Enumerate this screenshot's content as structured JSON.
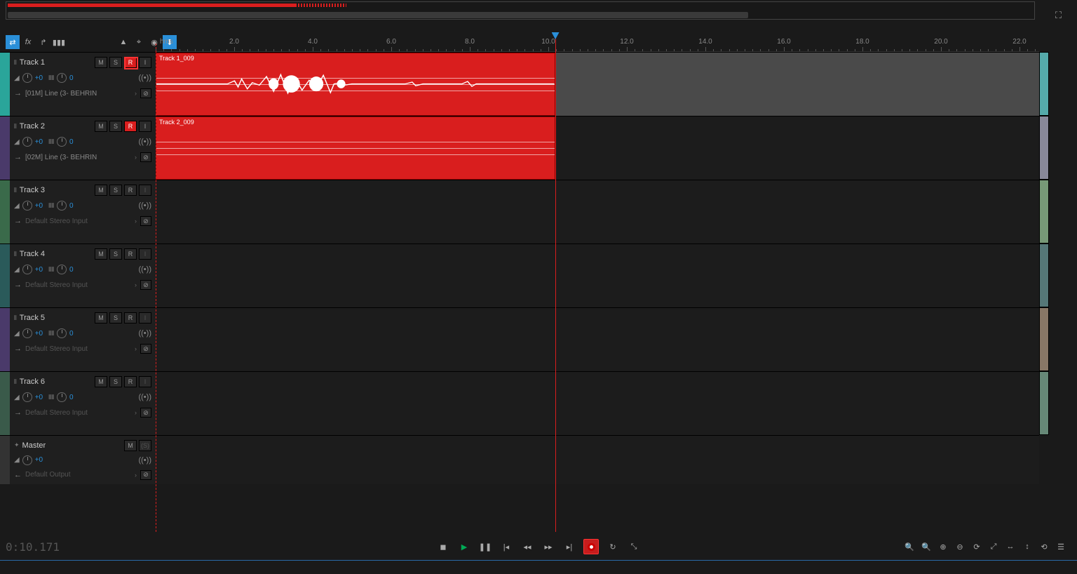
{
  "ruler": {
    "label": "hms",
    "marks": [
      "2.0",
      "4.0",
      "6.0",
      "8.0",
      "10.0",
      "12.0",
      "14.0",
      "16.0",
      "18.0",
      "20.0",
      "22.0"
    ]
  },
  "playhead_seconds": 10.171,
  "timecode": "0:10.171",
  "overview": {
    "red_width_pct": 28,
    "dash_start_pct": 28,
    "dash_width_pct": 5,
    "scroll_width_pct": 72
  },
  "tracks": [
    {
      "name": "Track 1",
      "color": "#2aa59a",
      "m": false,
      "s": false,
      "r": true,
      "i": true,
      "i_active": true,
      "vol": "+0",
      "pan": "0",
      "input": "[01M] Line (3- BEHRIN",
      "input_active": true,
      "clip": {
        "label": "Track 1_009",
        "has_wave": true
      },
      "show_peak_green": true,
      "highlight_r": true
    },
    {
      "name": "Track 2",
      "color": "#4a3a6a",
      "m": false,
      "s": false,
      "r": true,
      "i": true,
      "i_active": true,
      "vol": "+0",
      "pan": "0",
      "input": "[02M] Line (3- BEHRIN",
      "input_active": true,
      "clip": {
        "label": "Track 2_009",
        "has_wave": false
      }
    },
    {
      "name": "Track 3",
      "color": "#3a6a4a",
      "m": false,
      "s": false,
      "r": false,
      "i": false,
      "i_active": false,
      "vol": "+0",
      "pan": "0",
      "input": "Default Stereo Input",
      "input_active": false
    },
    {
      "name": "Track 4",
      "color": "#2a5a5a",
      "m": false,
      "s": false,
      "r": false,
      "i": false,
      "i_active": false,
      "vol": "+0",
      "pan": "0",
      "input": "Default Stereo Input",
      "input_active": false
    },
    {
      "name": "Track 5",
      "color": "#4a3a6a",
      "m": false,
      "s": false,
      "r": false,
      "i": false,
      "i_active": false,
      "vol": "+0",
      "pan": "0",
      "input": "Default Stereo Input",
      "input_active": false
    },
    {
      "name": "Track 6",
      "color": "#3a5a4a",
      "m": false,
      "s": false,
      "r": false,
      "i": false,
      "i_active": false,
      "vol": "+0",
      "pan": "0",
      "input": "Default Stereo Input",
      "input_active": false
    }
  ],
  "master": {
    "name": "Master",
    "vol": "+0",
    "output": "Default Output"
  },
  "msri_labels": {
    "m": "M",
    "s": "S",
    "r": "R",
    "i": "I",
    "ss": "(S)"
  },
  "transport": {
    "stop": "■",
    "play": "▶",
    "pause": "❙❙",
    "prev": "|◀",
    "rew": "◀◀",
    "ffw": "▶▶",
    "next": "▶|",
    "rec": "●",
    "loop": "↻",
    "skip": "↤↦"
  }
}
